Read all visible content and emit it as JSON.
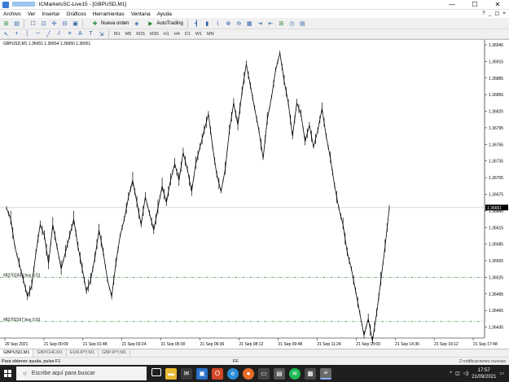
{
  "window": {
    "title_suffix": ": ICMarketsSC-Live15 - [GBPUSD,M1]",
    "minimize": "—",
    "maximize": "☐",
    "close": "✕"
  },
  "menu": {
    "items": [
      "Archivo",
      "Ver",
      "Insertar",
      "Gráficos",
      "Herramientas",
      "Ventana",
      "Ayuda"
    ],
    "mdi_ctrls": [
      "?",
      "_",
      "☐",
      "×"
    ]
  },
  "toolbar": {
    "new_order_label": "Nueva orden",
    "autotrading_label": "AutoTrading",
    "timeframes": [
      "M1",
      "M5",
      "M15",
      "M30",
      "H1",
      "H4",
      "D1",
      "W1",
      "MN"
    ]
  },
  "chart": {
    "symbol_line": "GBPUSD,M1  1.36651 1.36654 1.36650 1.36651",
    "order_label_1": "#82702433 buy 0.01",
    "order_label_2": "#82702167 buy 0.01",
    "price_labels": [
      "1.36945",
      "1.36915",
      "1.36885",
      "1.36855",
      "1.36825",
      "1.36795",
      "1.36765",
      "1.36735",
      "1.36705",
      "1.36675",
      "1.36645",
      "1.36615",
      "1.36585",
      "1.36555",
      "1.36525",
      "1.36495",
      "1.36465",
      "1.36435"
    ],
    "current_price": "1.36651",
    "time_labels": [
      "20 Sep 2021",
      "21 Sep 00:09",
      "21 Sep 01:48",
      "21 Sep 03:24",
      "21 Sep 05:00",
      "21 Sep 06:36",
      "21 Sep 08:12",
      "21 Sep 09:48",
      "21 Sep 11:24",
      "21 Sep 13:00",
      "21 Sep 14:36",
      "21 Sep 16:12",
      "21 Sep 17:48"
    ],
    "bid_color": "#c0c0c0",
    "order_line_color": "#3a8a3a"
  },
  "chart_data": {
    "type": "line",
    "series": [
      {
        "values": [
          1.3665,
          1.3663,
          1.3658,
          1.3655,
          1.3652,
          1.3649,
          1.3651,
          1.3657,
          1.3662,
          1.366,
          1.3655,
          1.3662,
          1.3658,
          1.3654,
          1.3657,
          1.366,
          1.3663,
          1.3658,
          1.3654,
          1.365,
          1.3652,
          1.3656,
          1.3661,
          1.3657,
          1.3652,
          1.3649,
          1.3655,
          1.366,
          1.3663,
          1.3667,
          1.367,
          1.3666,
          1.3662,
          1.3667,
          1.3664,
          1.3661,
          1.3665,
          1.3669,
          1.3666,
          1.367,
          1.3673,
          1.367,
          1.3675,
          1.3672,
          1.3668,
          1.3673,
          1.3676,
          1.3679,
          1.3682,
          1.3676,
          1.3671,
          1.3668,
          1.3672,
          1.3679,
          1.3684,
          1.368,
          1.3686,
          1.3691,
          1.3687,
          1.3683,
          1.3679,
          1.3674,
          1.3681,
          1.3685,
          1.369,
          1.3693,
          1.3688,
          1.3684,
          1.3678,
          1.3684,
          1.3682,
          1.3677,
          1.368,
          1.3676,
          1.3679,
          1.3683,
          1.3678,
          1.3674,
          1.3669,
          1.3665,
          1.3662,
          1.3657,
          1.3654,
          1.365,
          1.3646,
          1.3642,
          1.3645,
          1.3641,
          1.3646,
          1.3652,
          1.3658,
          1.3665
        ]
      }
    ],
    "ylim": [
      1.3643,
      1.36945
    ],
    "grid": false
  },
  "tabs": [
    "GBPUSD,M1",
    "GBPCHF,M1",
    "EURJPY,M1",
    "GBPJPY,M1"
  ],
  "status": {
    "help": "Para obtener ayuda, pulse F1",
    "mid": "FF",
    "notifications": "2 notificaciones nuevas"
  },
  "taskbar": {
    "search_placeholder": "Escribe aquí para buscar",
    "time": "17:57",
    "date": "21/09/2021"
  }
}
